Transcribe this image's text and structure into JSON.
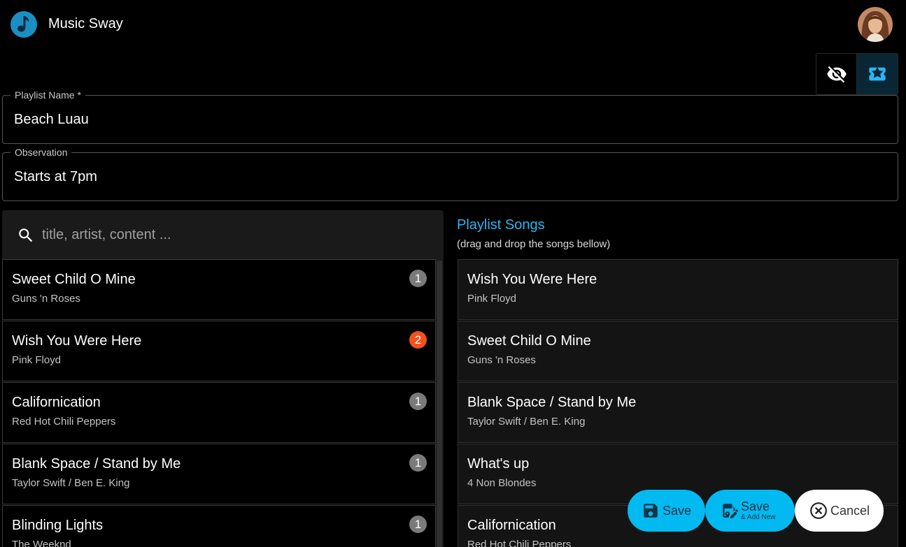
{
  "app": {
    "title": "Music Sway",
    "logo_icon": "music-note-icon",
    "avatar_icon": "user-avatar"
  },
  "toolbar": {
    "visibility_icon": "eye-off-icon",
    "ticket_icon": "ticket-star-icon"
  },
  "form": {
    "name_label": "Playlist Name *",
    "name_value": "Beach Luau",
    "observation_label": "Observation",
    "observation_value": "Starts at 7pm"
  },
  "search": {
    "placeholder": "title, artist, content ...",
    "icon": "search-icon"
  },
  "library": [
    {
      "title": "Sweet Child O Mine",
      "artist": "Guns 'n Roses",
      "count": "1",
      "badge_color": "#7a7a7a"
    },
    {
      "title": "Wish You Were Here",
      "artist": "Pink Floyd",
      "count": "2",
      "badge_color": "#f4511e"
    },
    {
      "title": "Californication",
      "artist": "Red Hot Chili Peppers",
      "count": "1",
      "badge_color": "#7a7a7a"
    },
    {
      "title": "Blank Space / Stand by Me",
      "artist": "Taylor Swift / Ben E. King",
      "count": "1",
      "badge_color": "#7a7a7a"
    },
    {
      "title": "Blinding Lights",
      "artist": "The Weeknd",
      "count": "1",
      "badge_color": "#7a7a7a"
    }
  ],
  "playlist": {
    "heading": "Playlist Songs",
    "hint": "(drag and drop the songs bellow)",
    "songs": [
      {
        "title": "Wish You Were Here",
        "artist": "Pink Floyd"
      },
      {
        "title": "Sweet Child O Mine",
        "artist": "Guns 'n Roses"
      },
      {
        "title": "Blank Space / Stand by Me",
        "artist": "Taylor Swift / Ben E. King"
      },
      {
        "title": "What's up",
        "artist": "4 Non Blondes"
      },
      {
        "title": "Californication",
        "artist": "Red Hot Chili Peppers"
      }
    ]
  },
  "actions": {
    "save_label": "Save",
    "save_new_label": "Save",
    "save_new_sub": "& Add New",
    "cancel_label": "Cancel"
  },
  "colors": {
    "accent": "#29b6f6",
    "fab": "#03b9f2",
    "badge_alert": "#f4511e"
  }
}
